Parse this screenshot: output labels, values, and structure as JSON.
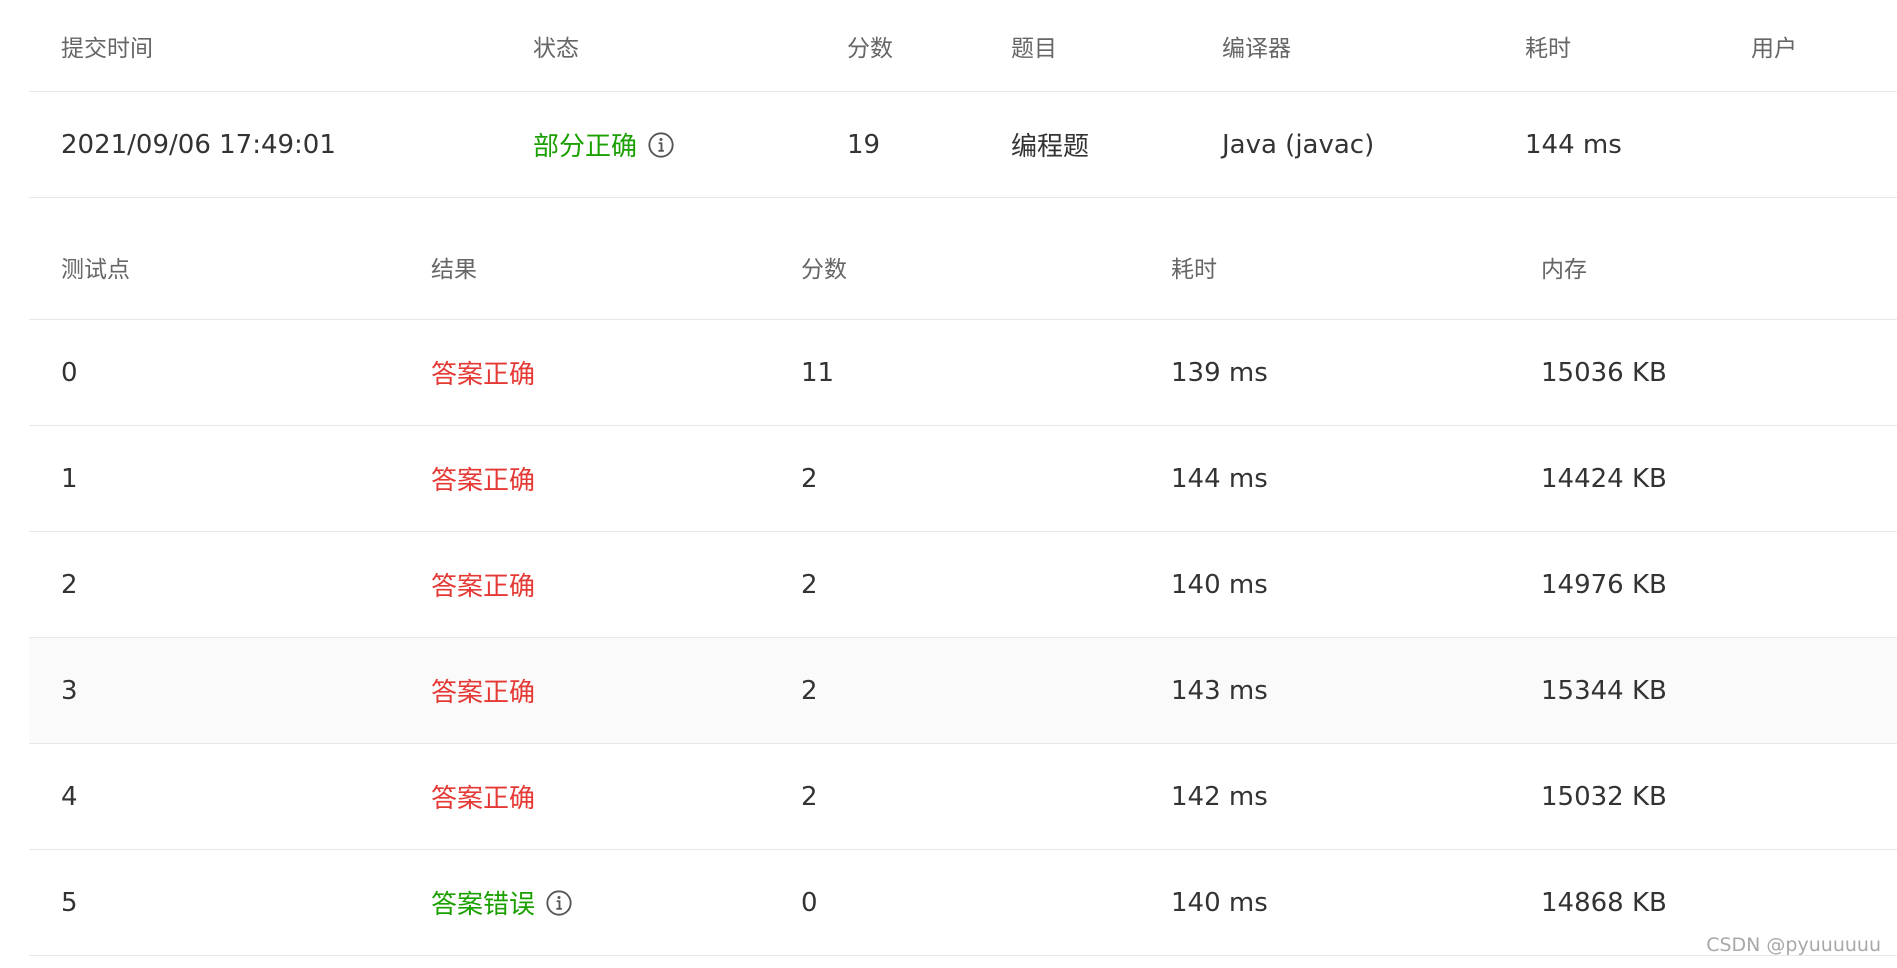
{
  "submission": {
    "headers": [
      "提交时间",
      "状态",
      "分数",
      "题目",
      "编译器",
      "耗时",
      "用户"
    ],
    "row": {
      "time": "2021/09/06 17:49:01",
      "status": "部分正确",
      "score": "19",
      "problem": "编程题",
      "compiler": "Java (javac)",
      "duration": "144 ms",
      "user": ""
    },
    "status_icon": "info-circle-icon"
  },
  "testcases": {
    "headers": [
      "测试点",
      "结果",
      "分数",
      "耗时",
      "内存"
    ],
    "rows": [
      {
        "id": "0",
        "result": "答案正确",
        "score": "11",
        "time": "139 ms",
        "memory": "15036 KB"
      },
      {
        "id": "1",
        "result": "答案正确",
        "score": "2",
        "time": "144 ms",
        "memory": "14424 KB"
      },
      {
        "id": "2",
        "result": "答案正确",
        "score": "2",
        "time": "140 ms",
        "memory": "14976 KB"
      },
      {
        "id": "3",
        "result": "答案正确",
        "score": "2",
        "time": "143 ms",
        "memory": "15344 KB"
      },
      {
        "id": "4",
        "result": "答案正确",
        "score": "2",
        "time": "142 ms",
        "memory": "15032 KB"
      },
      {
        "id": "5",
        "result": "答案错误",
        "score": "0",
        "time": "140 ms",
        "memory": "14868 KB"
      }
    ],
    "result_icon": "info-circle-icon"
  },
  "colors": {
    "accepted_text": "#e53935",
    "partial_and_wrong_text": "#1aa000",
    "header_text": "#666666",
    "divider": "#e8e8e8",
    "hover_row_bg": "#fafafa"
  },
  "watermark": "CSDN @pyuuuuuu"
}
